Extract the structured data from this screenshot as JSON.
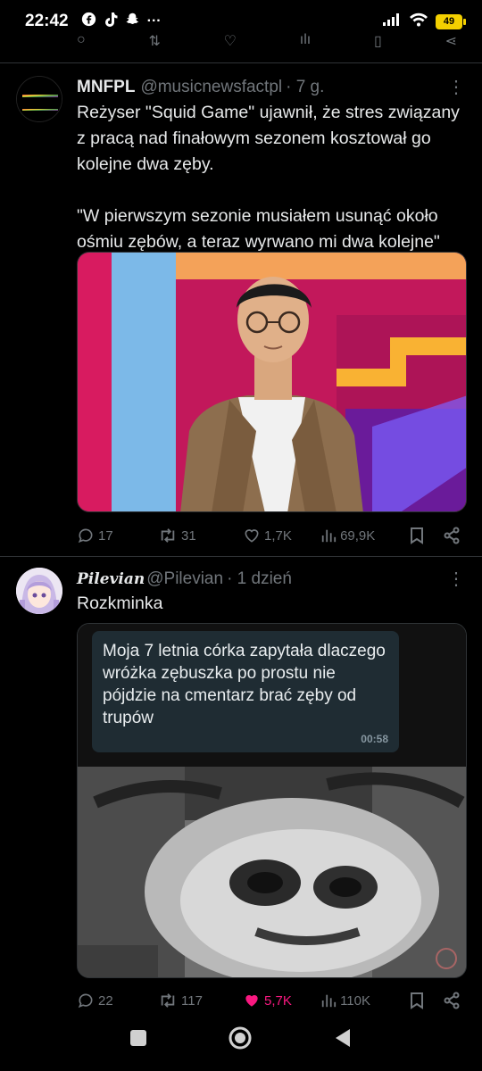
{
  "status_bar": {
    "time": "22:42",
    "app_icons": [
      "facebook-icon",
      "tiktok-icon",
      "snapchat-icon"
    ],
    "more": "···",
    "battery": "49"
  },
  "tweets": [
    {
      "name": "MNFPL",
      "handle": "@musicnewsfactpl",
      "time": "· 7 g.",
      "avatar_text": "MUSIC NEWS FACTS",
      "text": "Reżyser \"Squid Game\" ujawnił, że stres związany z pracą nad finałowym sezonem kosztował go kolejne dwa zęby.\n\n\"W pierwszym sezonie musiałem usunąć około ośmiu zębów, a teraz wyrwano mi dwa kolejne\"",
      "actions": {
        "replies": "17",
        "retweets": "31",
        "likes": "1,7K",
        "views": "69,9K"
      }
    },
    {
      "name": "Pilevian",
      "handle": "@Pilevian",
      "time": "· 1 dzień",
      "text": "Rozkminka",
      "chat_bubble": {
        "message": "Moja 7 letnia córka zapytała dlaczego wróżka zębuszka po prostu nie pójdzie na cmentarz brać zęby od trupów",
        "time": "00:58"
      },
      "actions": {
        "replies": "22",
        "retweets": "117",
        "likes": "5,7K",
        "views": "110K"
      }
    }
  ],
  "colors": {
    "like_active": "#f91880",
    "muted": "#71767b",
    "divider": "#2f3336"
  }
}
